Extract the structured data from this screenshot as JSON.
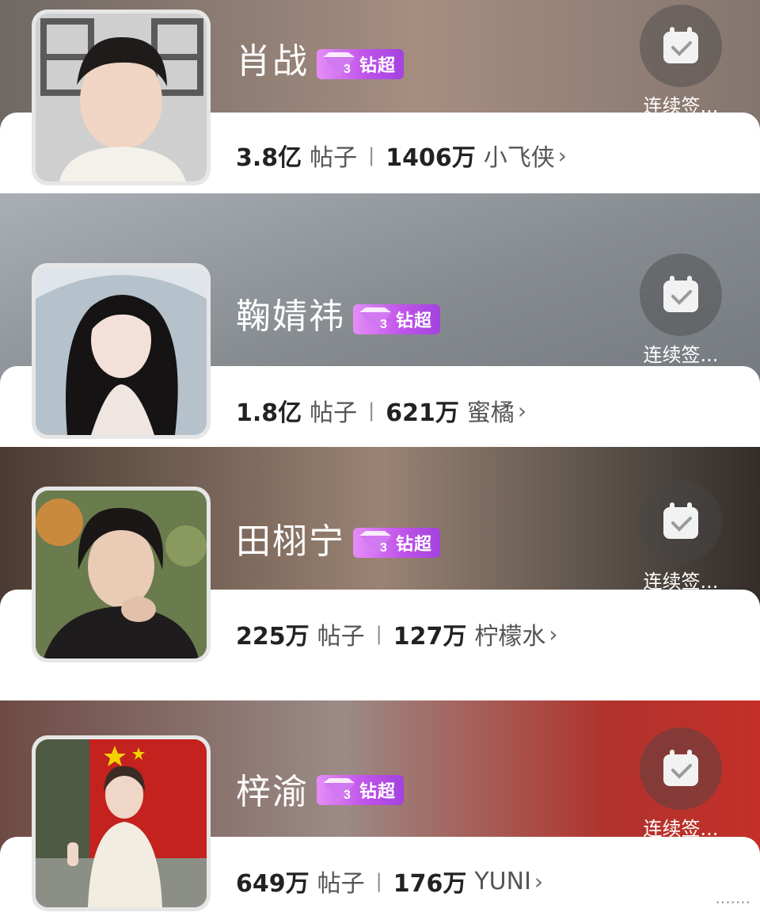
{
  "badge_label": "钻超",
  "signin_label": "连续签...",
  "posts_unit": "帖子",
  "separator": "|",
  "chevron": "›",
  "icons": {
    "badge": "diamond-level-3-icon",
    "signin": "calendar-check-icon"
  },
  "cards": [
    {
      "name": "肖战",
      "posts": "3.8亿",
      "fans": "1406万",
      "fan_name": "小飞侠",
      "bg_color": "#8c7b72"
    },
    {
      "name": "鞠婧祎",
      "posts": "1.8亿",
      "fans": "621万",
      "fan_name": "蜜橘",
      "bg_color": "#8e959b"
    },
    {
      "name": "田栩宁",
      "posts": "225万",
      "fans": "127万",
      "fan_name": "柠檬水",
      "bg_color": "#6e5a4f"
    },
    {
      "name": "梓渝",
      "posts": "649万",
      "fans": "176万",
      "fan_name": "YUNI",
      "bg_color": "#a23a36"
    }
  ],
  "watermark": "·······"
}
